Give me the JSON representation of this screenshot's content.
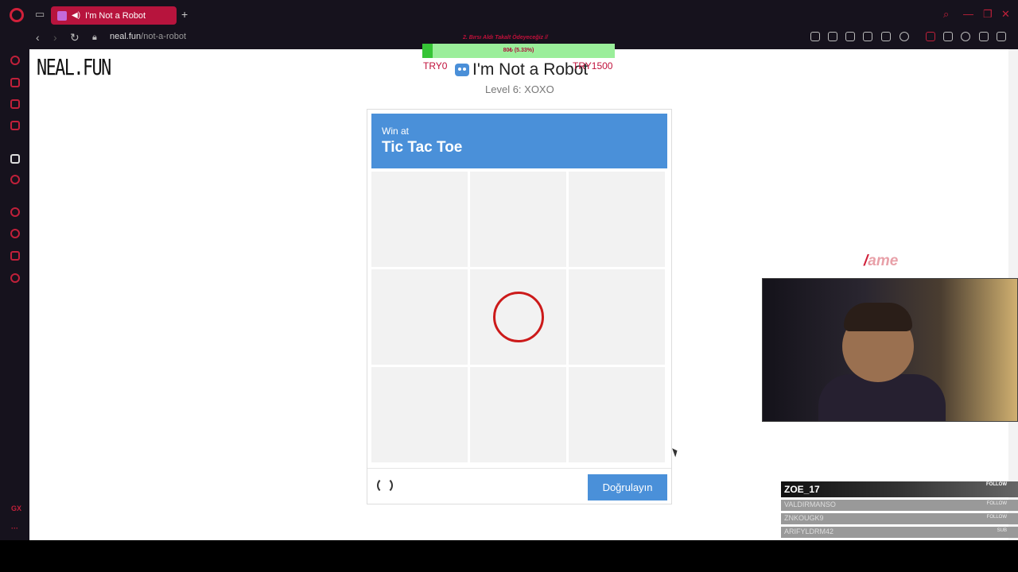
{
  "browser": {
    "tab_title": "I'm Not a Robot",
    "url_host": "neal.fun",
    "url_path": "/not-a-robot",
    "accent": "#b7143d"
  },
  "page": {
    "logo": "NEAL.FUN",
    "title": "I'm Not a Robot",
    "level": "Level 6: XOXO"
  },
  "overlay": {
    "goal_title": "2. Bırsı Aldı Takalt Ödeyeceğiz //",
    "goal_text": "80₺ (5.33%)",
    "goal_progress": 0.0533,
    "goal_min": "TRY0",
    "goal_max": "TRY1500",
    "brand": "ame"
  },
  "captcha": {
    "subtitle": "Win at",
    "heading": "Tic Tac Toe",
    "verify_label": "Doğrulayın",
    "board": [
      "",
      "",
      "",
      "",
      "O",
      "",
      "",
      "",
      ""
    ],
    "header_color": "#4a90d9"
  },
  "chat": {
    "rows": [
      {
        "name": "ZOE_17",
        "tag": "FOLLOW"
      },
      {
        "name": "VALDIRMANSO",
        "tag": "FOLLOW"
      },
      {
        "name": "ZNKOUGK9",
        "tag": "FOLLOW"
      },
      {
        "name": "ARIFYLDRM42",
        "tag": "SUB"
      }
    ]
  }
}
